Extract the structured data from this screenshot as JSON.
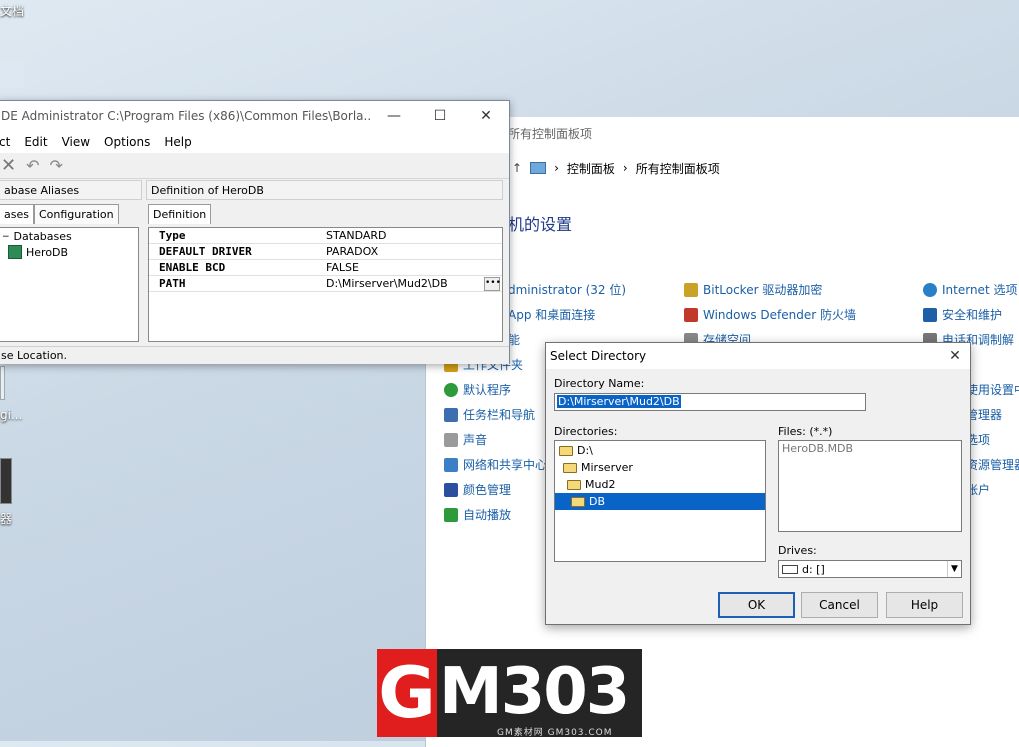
{
  "desktop": {
    "top_label": "文档",
    "label_2": "gi...",
    "label_3": "器"
  },
  "control_panel": {
    "title": "所有控制面板项",
    "breadcrumb": [
      "控制面板",
      "所有控制面板项"
    ],
    "heading": "机的设置",
    "items": [
      {
        "label": "dministrator (32 位)",
        "color": "#2d6ec4"
      },
      {
        "label": "BitLocker 驱动器加密",
        "color": "#6b6b6b"
      },
      {
        "label": "Internet 选项",
        "color": "#2a7fc9"
      },
      {
        "label": "App 和桌面连接",
        "color": "#2d6ec4"
      },
      {
        "label": "Windows Defender 防火墙",
        "color": "#c0392b"
      },
      {
        "label": "安全和维护",
        "color": "#1f5fa8"
      },
      {
        "label": "能",
        "color": "#2d6ec4"
      },
      {
        "label": "存储空间",
        "color": "#777"
      },
      {
        "label": "电话和调制解",
        "color": "#777"
      },
      {
        "label": "工作文件夹",
        "color": "#d4a017"
      },
      {
        "label": "默认程序",
        "color": "#2e9b3a"
      },
      {
        "label": "使用设置中",
        "color": "#777"
      },
      {
        "label": "任务栏和导航",
        "color": "#3d6fb0"
      },
      {
        "label": "管理器",
        "color": "#777"
      },
      {
        "label": "声音",
        "color": "#888"
      },
      {
        "label": "选项",
        "color": "#777"
      },
      {
        "label": "网络和共享中心",
        "color": "#3d7fc7"
      },
      {
        "label": "资源管理器",
        "color": "#777"
      },
      {
        "label": "颜色管理",
        "color": "#2b4f9e"
      },
      {
        "label": "帐户",
        "color": "#777"
      },
      {
        "label": "自动播放",
        "color": "#2e9b3a"
      }
    ]
  },
  "bde": {
    "title": "DE Administrator  C:\\Program Files (x86)\\Common Files\\Borla...",
    "menu": [
      "ct",
      "Edit",
      "View",
      "Options",
      "Help"
    ],
    "left_header": "abase Aliases",
    "right_header": "Definition of HeroDB",
    "tabs_left": [
      "ases",
      "Configuration"
    ],
    "tab_right": "Definition",
    "tree": {
      "root": "Databases",
      "child": "HeroDB"
    },
    "definition": [
      {
        "key": "Type",
        "value": "STANDARD"
      },
      {
        "key": "DEFAULT DRIVER",
        "value": "PARADOX"
      },
      {
        "key": "ENABLE BCD",
        "value": "FALSE"
      },
      {
        "key": "PATH",
        "value": "D:\\Mirserver\\Mud2\\DB"
      }
    ],
    "status": "se Location."
  },
  "dialog": {
    "title": "Select Directory",
    "dir_name_label": "Directory Name:",
    "dir_name_value": "D:\\Mirserver\\Mud2\\DB",
    "directories_label": "Directories:",
    "directories": [
      "D:\\",
      "Mirserver",
      "Mud2",
      "DB"
    ],
    "files_label": "Files: (*.*)",
    "files": [
      "HeroDB.MDB"
    ],
    "drives_label": "Drives:",
    "drive_value": "d: []",
    "ok": "OK",
    "cancel": "Cancel",
    "help": "Help"
  },
  "watermark": {
    "g": "G",
    "rest": "M303",
    "sub": "GM素材网 GM303.COM"
  }
}
